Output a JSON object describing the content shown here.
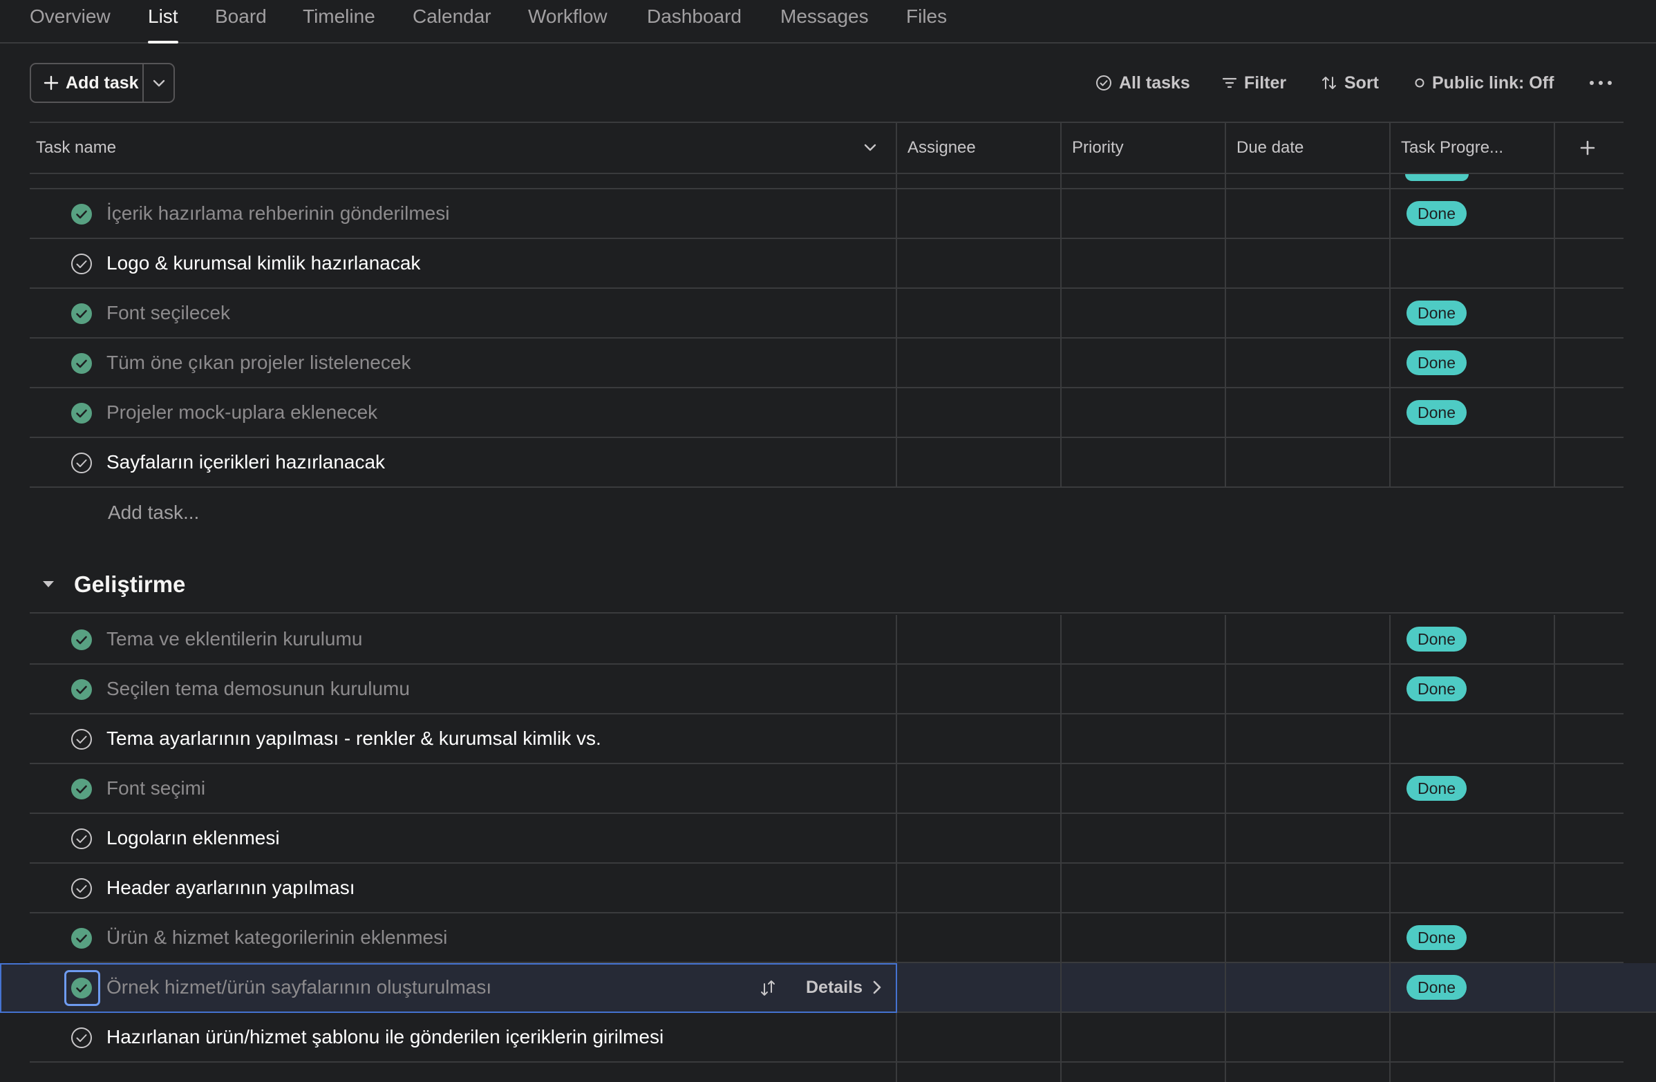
{
  "tabs": [
    "Overview",
    "List",
    "Board",
    "Timeline",
    "Calendar",
    "Workflow",
    "Dashboard",
    "Messages",
    "Files"
  ],
  "active_tab": "List",
  "toolbar": {
    "add_task": "Add task",
    "all_tasks": "All tasks",
    "filter": "Filter",
    "sort": "Sort",
    "public_link": "Public link: Off"
  },
  "columns": {
    "task_name": "Task name",
    "assignee": "Assignee",
    "priority": "Priority",
    "due_date": "Due date",
    "task_progress": "Task Progre..."
  },
  "section1_rows": [
    {
      "name": "İçerik hazırlama rehberinin gönderilmesi",
      "completed": true,
      "progress": "Done"
    },
    {
      "name": "Logo & kurumsal kimlik hazırlanacak",
      "completed": false,
      "progress": ""
    },
    {
      "name": "Font seçilecek",
      "completed": true,
      "progress": "Done"
    },
    {
      "name": "Tüm öne çıkan projeler listelenecek",
      "completed": true,
      "progress": "Done"
    },
    {
      "name": "Projeler mock-uplara eklenecek",
      "completed": true,
      "progress": "Done"
    },
    {
      "name": "Sayfaların içerikleri hazırlanacak",
      "completed": false,
      "progress": ""
    }
  ],
  "add_task_row": "Add task...",
  "section2": {
    "title": "Geliştirme",
    "rows": [
      {
        "name": "Tema ve eklentilerin kurulumu",
        "completed": true,
        "progress": "Done"
      },
      {
        "name": "Seçilen tema demosunun kurulumu",
        "completed": true,
        "progress": "Done"
      },
      {
        "name": "Tema ayarlarının yapılması - renkler & kurumsal kimlik vs.",
        "completed": false,
        "progress": ""
      },
      {
        "name": "Font seçimi",
        "completed": true,
        "progress": "Done"
      },
      {
        "name": "Logoların eklenmesi",
        "completed": false,
        "progress": ""
      },
      {
        "name": "Header ayarlarının yapılması",
        "completed": false,
        "progress": ""
      },
      {
        "name": "Ürün & hizmet kategorilerinin eklenmesi",
        "completed": true,
        "progress": "Done"
      },
      {
        "name": "Örnek hizmet/ürün sayfalarının oluşturulması",
        "completed": true,
        "progress": "Done",
        "selected": true
      },
      {
        "name": "Hazırlanan ürün/hizmet şablonu ile gönderilen içeriklerin girilmesi",
        "completed": false,
        "progress": ""
      }
    ]
  },
  "row_details_label": "Details",
  "colors": {
    "background": "#1e1f21",
    "done_badge": "#4ecbc4",
    "check_done": "#58a182",
    "selection": "#4573d2"
  }
}
